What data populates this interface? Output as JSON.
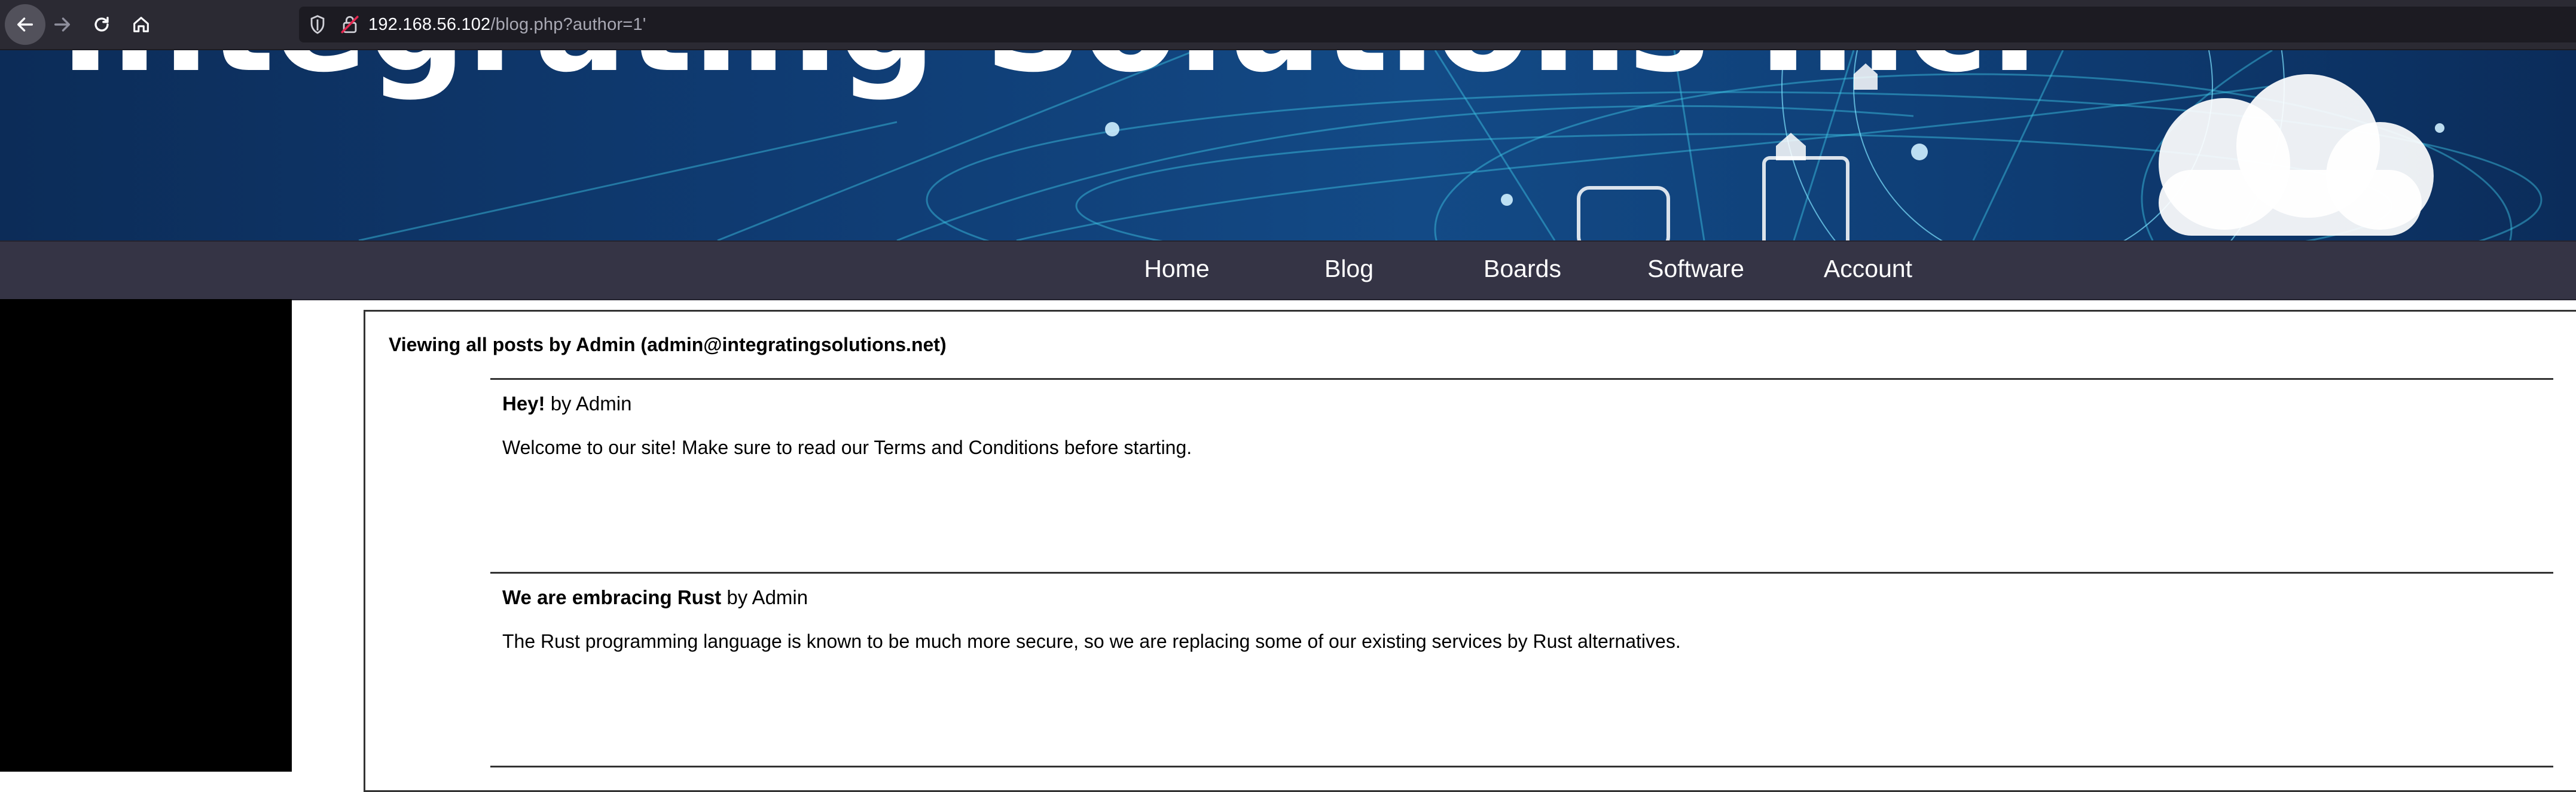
{
  "browser": {
    "url_host": "192.168.56.102",
    "url_path": "/blog.php?author=1'"
  },
  "site": {
    "banner_title": "Integrating Solutions Inc."
  },
  "nav": {
    "items": [
      "Home",
      "Blog",
      "Boards",
      "Software",
      "Account"
    ]
  },
  "page": {
    "heading": "Viewing all posts by Admin (admin@integratingsolutions.net)",
    "posts": [
      {
        "title": "Hey!",
        "byline": " by Admin",
        "body": "Welcome to our site! Make sure to read our Terms and Conditions before starting."
      },
      {
        "title": "We are embracing Rust",
        "byline": " by Admin",
        "body": "The Rust programming language is known to be much more secure, so we are replacing some of our existing services by Rust alternatives."
      }
    ]
  },
  "colors": {
    "chrome_bg": "#2b2a33",
    "urlbar_bg": "#1c1b22",
    "nav_bg": "#353445",
    "banner_blue": "#0f3b72"
  }
}
